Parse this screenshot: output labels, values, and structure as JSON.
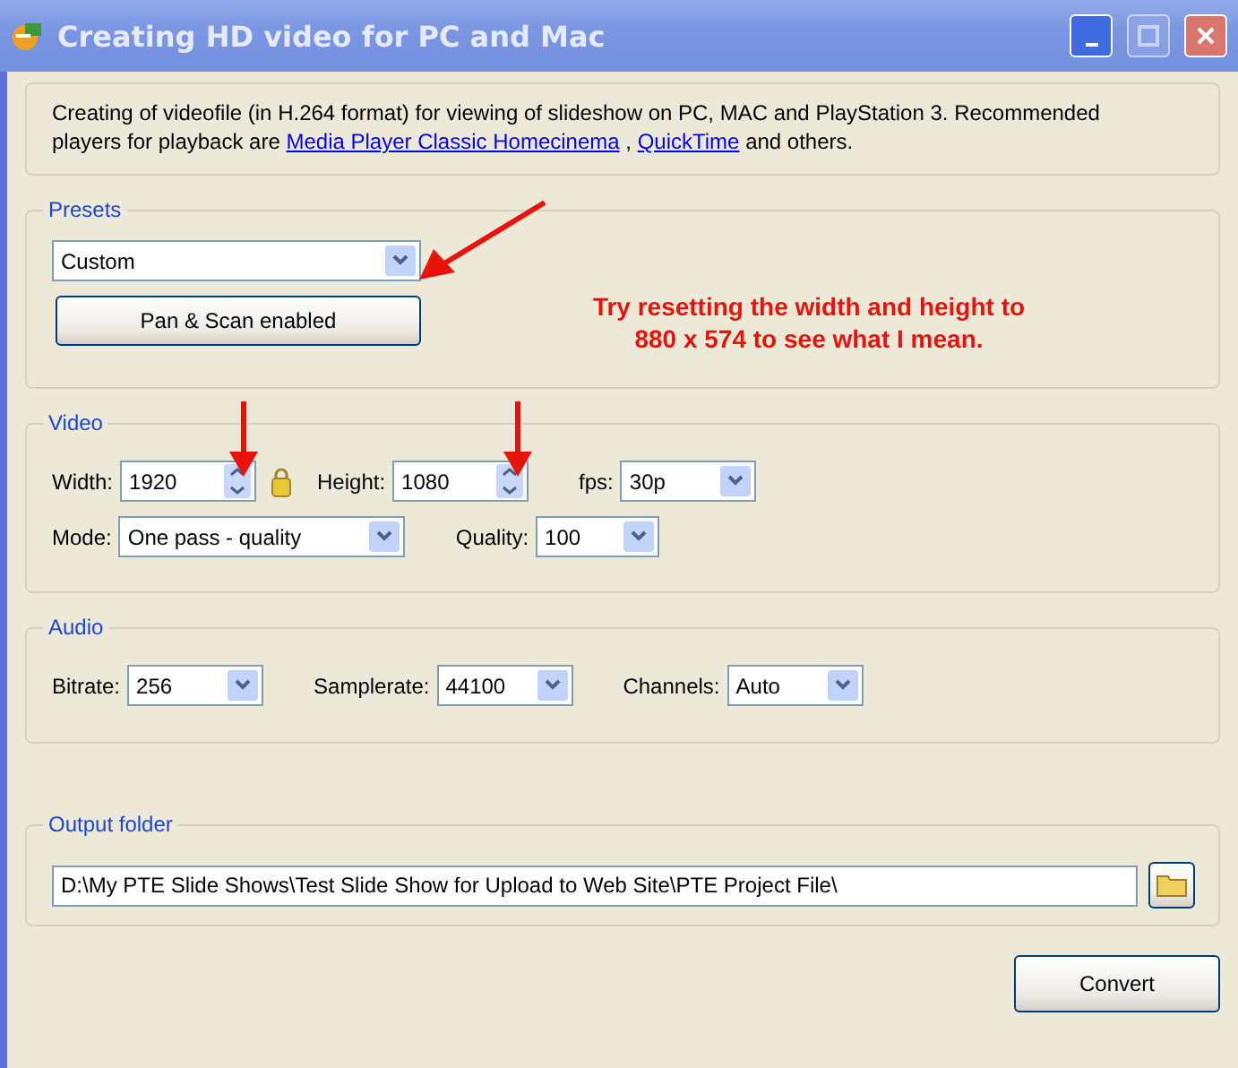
{
  "window": {
    "title": "Creating HD video for PC and Mac",
    "buttons": [
      {
        "kind": "minimize",
        "disabled": false
      },
      {
        "kind": "maximize",
        "disabled": true
      },
      {
        "kind": "close",
        "disabled": false
      }
    ]
  },
  "description": [
    {
      "kind": "text",
      "text": "Creating of videofile (in H.264 format) for viewing of slideshow on PC, MAC and PlayStation 3. Recommended players for playback are "
    },
    {
      "kind": "link",
      "text": "Media Player Classic Homecinema"
    },
    {
      "kind": "text",
      "text": " , "
    },
    {
      "kind": "link",
      "text": "QuickTime"
    },
    {
      "kind": "text",
      "text": " and others."
    }
  ],
  "presets": {
    "legend": "Presets",
    "value": "Custom",
    "button": "Pan & Scan enabled"
  },
  "note": [
    "Try resetting the width and height to",
    "880 x 574 to see what I mean."
  ],
  "video": {
    "legend": "Video",
    "rows": [
      [
        {
          "kind": "spin",
          "label": "Width:",
          "value": "1920"
        },
        {
          "kind": "lock"
        },
        {
          "kind": "spin",
          "label": "Height:",
          "value": "1080"
        },
        {
          "kind": "combo",
          "label": "fps:",
          "value": "30p"
        }
      ],
      [
        {
          "kind": "combo",
          "label": "Mode:",
          "value": "One pass - quality"
        },
        {
          "kind": "combo",
          "label": "Quality:",
          "value": "100"
        }
      ]
    ]
  },
  "audio": {
    "legend": "Audio",
    "rows": [
      [
        {
          "kind": "combo",
          "label": "Bitrate:",
          "value": "256"
        },
        {
          "kind": "combo",
          "label": "Samplerate:",
          "value": "44100"
        },
        {
          "kind": "combo",
          "label": "Channels:",
          "value": "Auto"
        }
      ]
    ]
  },
  "output": {
    "legend": "Output folder",
    "value": "D:\\My PTE Slide Shows\\Test Slide Show for Upload to Web Site\\PTE Project File\\"
  },
  "convert": "Convert"
}
